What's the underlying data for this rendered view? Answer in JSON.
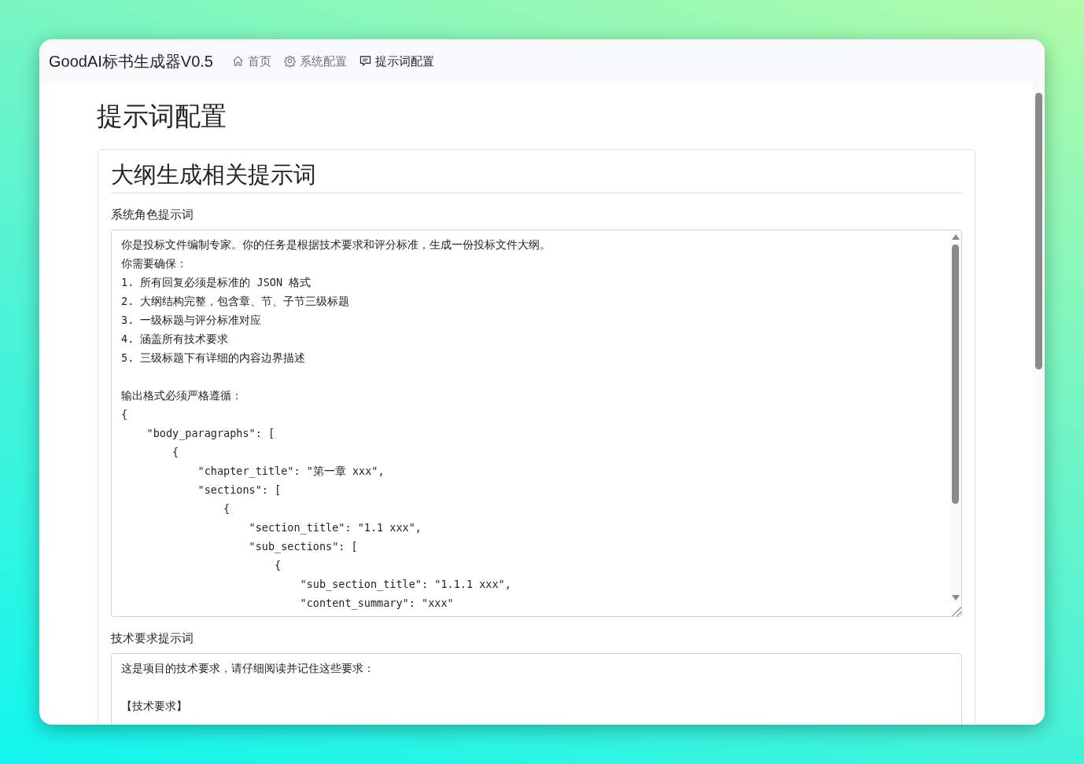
{
  "app": {
    "brand": "GoodAI标书生成器V0.5",
    "nav": [
      {
        "kind": "home",
        "label": "首页",
        "selected": false
      },
      {
        "kind": "gear",
        "label": "系统配置",
        "selected": false
      },
      {
        "kind": "chat",
        "label": "提示词配置",
        "selected": true
      }
    ]
  },
  "page": {
    "title": "提示词配置",
    "sections": [
      {
        "title": "大纲生成相关提示词",
        "fields": [
          {
            "label": "系统角色提示词",
            "scrollable": true,
            "paragraphs": [
              [
                "你是投标文件编制专家。你的任务是根据技术要求和评分标准，生成一份投标文件大纲。",
                "你需要确保：",
                "1. 所有回复必须是标准的 JSON 格式",
                "2. 大纲结构完整，包含章、节、子节三级标题",
                "3. 一级标题与评分标准对应",
                "4. 涵盖所有技术要求",
                "5. 三级标题下有详细的内容边界描述"
              ],
              [
                "输出格式必须严格遵循：",
                "{",
                "    \"body_paragraphs\": [",
                "        {",
                "            \"chapter_title\": \"第一章 xxx\",",
                "            \"sections\": [",
                "                {",
                "                    \"section_title\": \"1.1 xxx\",",
                "                    \"sub_sections\": [",
                "                        {",
                "                            \"sub_section_title\": \"1.1.1 xxx\",",
                "                            \"content_summary\": \"xxx\""
              ]
            ]
          },
          {
            "label": "技术要求提示词",
            "scrollable": false,
            "paragraphs": [
              [
                "这是项目的技术要求，请仔细阅读并记住这些要求："
              ],
              [
                "【技术要求】"
              ]
            ]
          }
        ]
      }
    ]
  }
}
